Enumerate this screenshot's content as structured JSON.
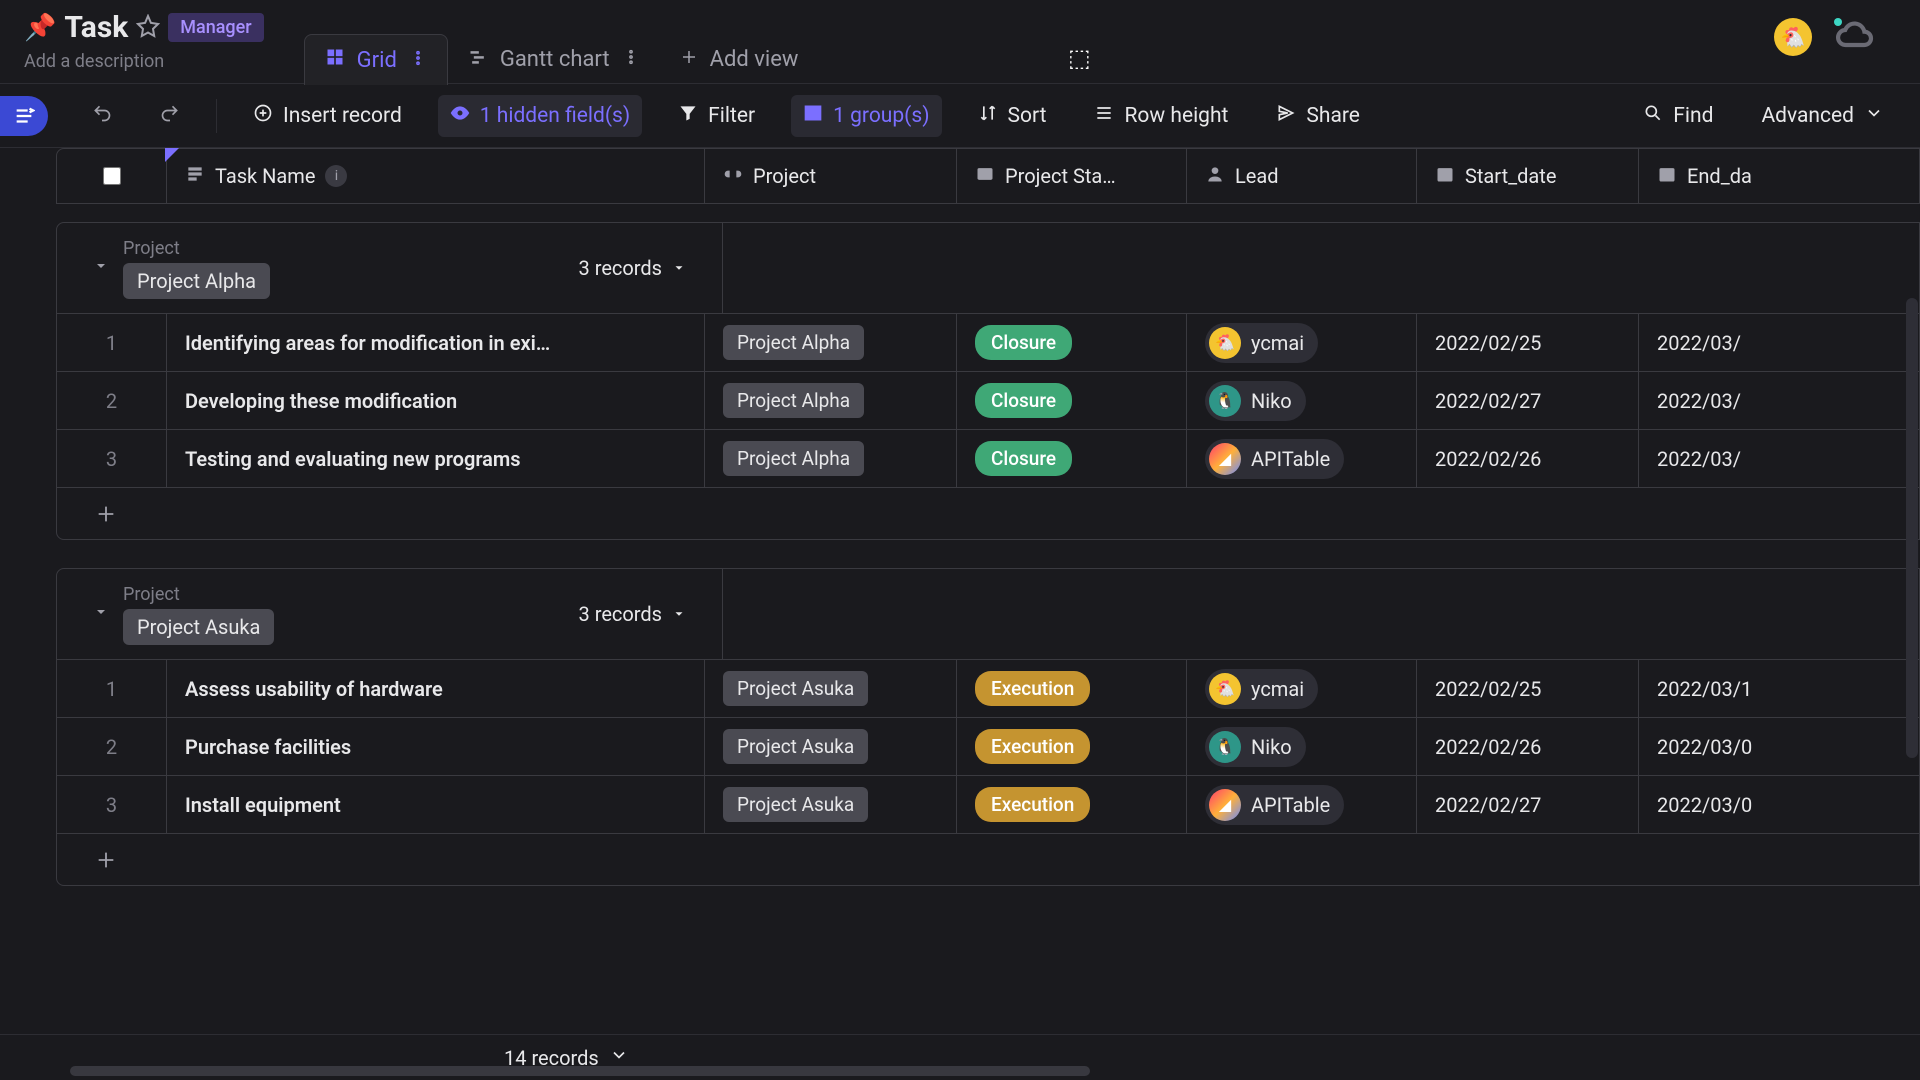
{
  "header": {
    "pin_emoji": "📌",
    "title": "Task",
    "badge": "Manager",
    "description_placeholder": "Add a description"
  },
  "tabs": {
    "grid": "Grid",
    "gantt": "Gantt chart",
    "add_view": "Add view"
  },
  "toolbar": {
    "insert_record": "Insert record",
    "hidden_fields": "1 hidden field(s)",
    "filter": "Filter",
    "groups": "1 group(s)",
    "sort": "Sort",
    "row_height": "Row height",
    "share": "Share",
    "find": "Find",
    "advanced": "Advanced"
  },
  "columns": {
    "task_name": "Task Name",
    "project": "Project",
    "project_status": "Project Sta…",
    "lead": "Lead",
    "start_date": "Start_date",
    "end_date": "End_da"
  },
  "group_field_label": "Project",
  "groups": [
    {
      "name": "Project Alpha",
      "count": "3 records",
      "rows": [
        {
          "idx": "1",
          "task": "Identifying areas for modification in exi…",
          "project": "Project Alpha",
          "status": "Closure",
          "status_class": "status-green",
          "lead_name": "ycmai",
          "lead_av": "av-yellow",
          "lead_glyph": "🐔",
          "start": "2022/02/25",
          "end": "2022/03/"
        },
        {
          "idx": "2",
          "task": "Developing these modification",
          "project": "Project Alpha",
          "status": "Closure",
          "status_class": "status-green",
          "lead_name": "Niko",
          "lead_av": "av-teal",
          "lead_glyph": "🐧",
          "start": "2022/02/27",
          "end": "2022/03/"
        },
        {
          "idx": "3",
          "task": "Testing and evaluating new programs",
          "project": "Project Alpha",
          "status": "Closure",
          "status_class": "status-green",
          "lead_name": "APITable",
          "lead_av": "av-multi",
          "lead_glyph": "◢",
          "start": "2022/02/26",
          "end": "2022/03/"
        }
      ]
    },
    {
      "name": "Project Asuka",
      "count": "3 records",
      "rows": [
        {
          "idx": "1",
          "task": "Assess usability of hardware",
          "project": "Project Asuka",
          "status": "Execution",
          "status_class": "status-yellow",
          "lead_name": "ycmai",
          "lead_av": "av-yellow",
          "lead_glyph": "🐔",
          "start": "2022/02/25",
          "end": "2022/03/1"
        },
        {
          "idx": "2",
          "task": "Purchase facilities",
          "project": "Project Asuka",
          "status": "Execution",
          "status_class": "status-yellow",
          "lead_name": "Niko",
          "lead_av": "av-teal",
          "lead_glyph": "🐧",
          "start": "2022/02/26",
          "end": "2022/03/0"
        },
        {
          "idx": "3",
          "task": "Install equipment",
          "project": "Project Asuka",
          "status": "Execution",
          "status_class": "status-yellow",
          "lead_name": "APITable",
          "lead_av": "av-multi",
          "lead_glyph": "◢",
          "start": "2022/02/27",
          "end": "2022/03/0"
        }
      ]
    }
  ],
  "footer": {
    "total": "14 records"
  }
}
